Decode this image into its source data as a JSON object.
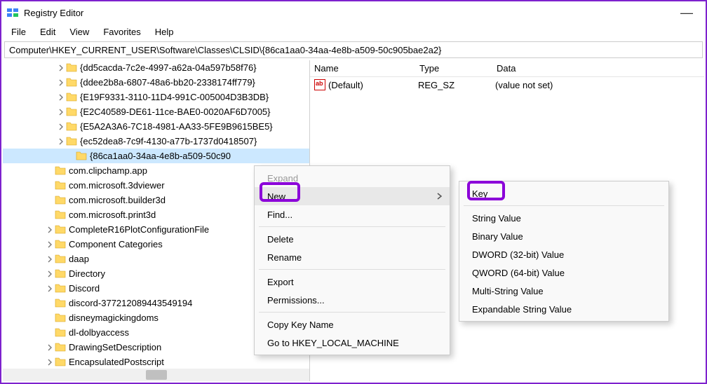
{
  "title": "Registry Editor",
  "window": {
    "minimize_glyph": "—"
  },
  "menu": {
    "items": [
      "File",
      "Edit",
      "View",
      "Favorites",
      "Help"
    ]
  },
  "address": "Computer\\HKEY_CURRENT_USER\\Software\\Classes\\CLSID\\{86ca1aa0-34aa-4e8b-a509-50c905bae2a2}",
  "tree": [
    {
      "indent": 76,
      "chev": true,
      "label": "{dd5cacda-7c2e-4997-a62a-04a597b58f76}"
    },
    {
      "indent": 76,
      "chev": true,
      "label": "{ddee2b8a-6807-48a6-bb20-2338174ff779}"
    },
    {
      "indent": 76,
      "chev": true,
      "label": "{E19F9331-3110-11D4-991C-005004D3B3DB}"
    },
    {
      "indent": 76,
      "chev": true,
      "label": "{E2C40589-DE61-11ce-BAE0-0020AF6D7005}"
    },
    {
      "indent": 76,
      "chev": true,
      "label": "{E5A2A3A6-7C18-4981-AA33-5FE9B9615BE5}"
    },
    {
      "indent": 76,
      "chev": true,
      "label": "{ec52dea8-7c9f-4130-a77b-1737d0418507}"
    },
    {
      "indent": 90,
      "chev": false,
      "label": "{86ca1aa0-34aa-4e8b-a509-50c90",
      "sel": true
    },
    {
      "indent": 60,
      "chev": false,
      "label": "com.clipchamp.app"
    },
    {
      "indent": 60,
      "chev": false,
      "label": "com.microsoft.3dviewer"
    },
    {
      "indent": 60,
      "chev": false,
      "label": "com.microsoft.builder3d"
    },
    {
      "indent": 60,
      "chev": false,
      "label": "com.microsoft.print3d"
    },
    {
      "indent": 60,
      "chev": true,
      "label": "CompleteR16PlotConfigurationFile"
    },
    {
      "indent": 60,
      "chev": true,
      "label": "Component Categories"
    },
    {
      "indent": 60,
      "chev": true,
      "label": "daap"
    },
    {
      "indent": 60,
      "chev": true,
      "label": "Directory"
    },
    {
      "indent": 60,
      "chev": true,
      "label": "Discord"
    },
    {
      "indent": 60,
      "chev": false,
      "label": "discord-377212089443549194"
    },
    {
      "indent": 60,
      "chev": false,
      "label": "disneymagickingdoms"
    },
    {
      "indent": 60,
      "chev": false,
      "label": "dl-dolbyaccess"
    },
    {
      "indent": 60,
      "chev": true,
      "label": "DrawingSetDescription"
    },
    {
      "indent": 60,
      "chev": true,
      "label": "EncapsulatedPostscript"
    }
  ],
  "cols": {
    "name": "Name",
    "type": "Type",
    "data": "Data"
  },
  "value": {
    "name": "(Default)",
    "type": "REG_SZ",
    "data": "(value not set)"
  },
  "ctx1": {
    "expand": "Expand",
    "new": "New",
    "find": "Find...",
    "delete": "Delete",
    "rename": "Rename",
    "export": "Export",
    "perm": "Permissions...",
    "copy": "Copy Key Name",
    "goto": "Go to HKEY_LOCAL_MACHINE"
  },
  "ctx2": {
    "key": "Key",
    "string": "String Value",
    "binary": "Binary Value",
    "dword": "DWORD (32-bit) Value",
    "qword": "QWORD (64-bit) Value",
    "multi": "Multi-String Value",
    "expand": "Expandable String Value"
  }
}
